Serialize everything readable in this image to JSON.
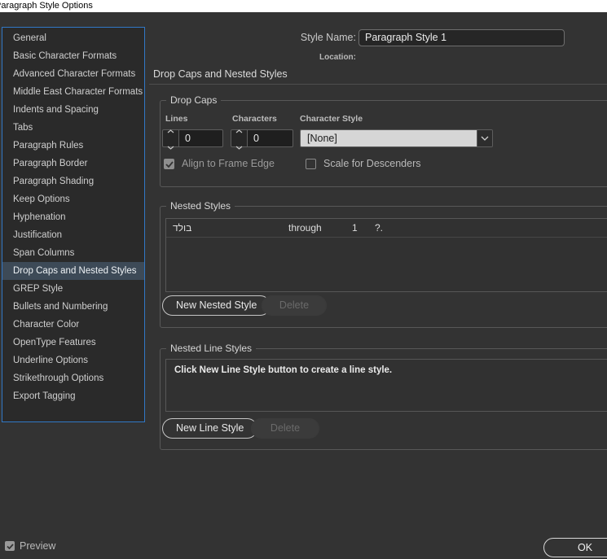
{
  "window": {
    "title": "Paragraph Style Options"
  },
  "colors": {
    "dialog_bg": "#333333",
    "sidebar_focus_border": "#3178c6",
    "selected_item_bg": "#3d4a57",
    "dropdown_field_bg": "#d6d6d6"
  },
  "sidebar": {
    "items": [
      {
        "label": "General",
        "selected": false
      },
      {
        "label": "Basic Character Formats",
        "selected": false
      },
      {
        "label": "Advanced Character Formats",
        "selected": false
      },
      {
        "label": "Middle East Character Formats",
        "selected": false
      },
      {
        "label": "Indents and Spacing",
        "selected": false
      },
      {
        "label": "Tabs",
        "selected": false
      },
      {
        "label": "Paragraph Rules",
        "selected": false
      },
      {
        "label": "Paragraph Border",
        "selected": false
      },
      {
        "label": "Paragraph Shading",
        "selected": false
      },
      {
        "label": "Keep Options",
        "selected": false
      },
      {
        "label": "Hyphenation",
        "selected": false
      },
      {
        "label": "Justification",
        "selected": false
      },
      {
        "label": "Span Columns",
        "selected": false
      },
      {
        "label": "Drop Caps and Nested Styles",
        "selected": true
      },
      {
        "label": "GREP Style",
        "selected": false
      },
      {
        "label": "Bullets and Numbering",
        "selected": false
      },
      {
        "label": "Character Color",
        "selected": false
      },
      {
        "label": "OpenType Features",
        "selected": false
      },
      {
        "label": "Underline Options",
        "selected": false
      },
      {
        "label": "Strikethrough Options",
        "selected": false
      },
      {
        "label": "Export Tagging",
        "selected": false
      }
    ]
  },
  "header": {
    "style_name_label": "Style Name:",
    "style_name_value": "Paragraph Style 1",
    "location_label": "Location:"
  },
  "panel": {
    "title": "Drop Caps and Nested Styles"
  },
  "drop_caps": {
    "legend": "Drop Caps",
    "lines_label": "Lines",
    "lines_value": "0",
    "characters_label": "Characters",
    "characters_value": "0",
    "character_style_label": "Character Style",
    "character_style_value": "[None]",
    "align_checkbox": {
      "label": "Align to Frame Edge",
      "checked": true,
      "disabled": true
    },
    "scale_checkbox": {
      "label": "Scale for Descenders",
      "checked": false,
      "disabled": false
    }
  },
  "nested_styles": {
    "legend": "Nested Styles",
    "rows": [
      {
        "style": "בולד",
        "mode": "through",
        "count": "1",
        "element": "?."
      }
    ],
    "new_button": "New Nested Style",
    "delete_button": "Delete",
    "delete_disabled": true
  },
  "nested_line_styles": {
    "legend": "Nested Line Styles",
    "empty_message": "Click New Line Style button to create a line style.",
    "new_button": "New Line Style",
    "delete_button": "Delete",
    "delete_disabled": true
  },
  "footer": {
    "preview_label": "Preview",
    "preview_checked": true,
    "ok_button": "OK"
  }
}
